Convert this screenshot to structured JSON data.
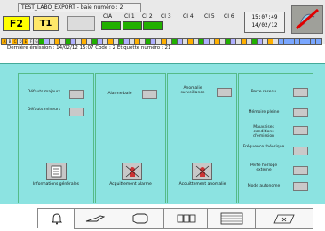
{
  "header": {
    "title": "TEST_LABO_EXPORT - baie numéro : 2",
    "badges": {
      "f2": "F2",
      "t1": "T1"
    },
    "ci_labels": [
      "CIA",
      "CI 1",
      "CI 2",
      "CI 3",
      "CI 4",
      "CI 5",
      "CI 6"
    ],
    "ci_led_colors": [
      "#22b000",
      "#22b000",
      "#22b000",
      null,
      null,
      null,
      null
    ],
    "clock": {
      "time": "15:07:49",
      "date": "14/02/12"
    }
  },
  "indicators": {
    "letters": [
      "A",
      "B",
      "C",
      "D",
      "E",
      "F",
      "G"
    ],
    "count": 60
  },
  "info": {
    "text": "Dernière émission : 14/02/12 15:07  Code : 2  Étiquette numéro : 21"
  },
  "sections": [
    {
      "items": [
        {
          "label": "Défauts majeurs"
        },
        {
          "label": "Défauts mineurs"
        }
      ],
      "button": {
        "caption": "Informations générales"
      }
    },
    {
      "items": [
        {
          "label": "Alarme baie"
        }
      ],
      "button": {
        "caption": "Acquittement alarme"
      }
    },
    {
      "items": [
        {
          "label": "Anomalie surveillance"
        }
      ],
      "button": {
        "caption": "Acquittement anomalie"
      }
    },
    {
      "items": [
        {
          "label": "Perte réseau"
        },
        {
          "label": "Mémoire pleine"
        },
        {
          "label": "Mauvaises conditions d'émission"
        },
        {
          "label": "Fréquence théorique"
        },
        {
          "label": "Perte horloge externe"
        },
        {
          "label": "Mode autonome"
        }
      ]
    }
  ],
  "tabs": [
    {
      "icon": "bell-icon"
    },
    {
      "icon": "tool-icon"
    },
    {
      "icon": "shape-icon"
    },
    {
      "icon": "racks-icon"
    },
    {
      "icon": "list-icon"
    },
    {
      "icon": "export-icon"
    }
  ],
  "colors": {
    "panel": "#8ce3e1",
    "header_bg": "#e9e9e9",
    "led_on": "#22b000"
  }
}
